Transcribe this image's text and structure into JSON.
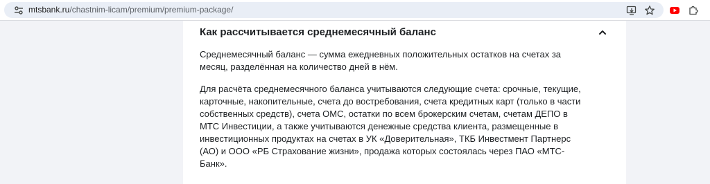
{
  "browser": {
    "url_host": "mtsbank.ru",
    "url_path": "/chastnim-licam/premium/premium-package/"
  },
  "accordion": {
    "title": "Как рассчитывается среднемесячный баланс",
    "expanded": true,
    "paragraphs": [
      "Среднемесячный баланс — сумма ежедневных положительных остатков на счетах за месяц, разделённая на количество дней в нём.",
      "Для расчёта среднемесячного баланса учитываются следующие счета: срочные, текущие, карточные, накопительные, счета до востребования, счета кредитных карт (только в части собственных средств), счета ОМС, остатки по всем брокерским счетам, счетам ДЕПО в МТС Инвестиции, а также учитываются денежные средства клиента, размещенные в инвестиционных продуктах на счетах в УК «Доверительная», ТКБ Инвестмент Партнерс (АО) и ООО «РБ Страхование жизни», продажа которых состоялась через ПАО «МТС-Банк»."
    ]
  },
  "icons": {
    "site_info": "site-settings-icon",
    "install": "install-app-icon",
    "bookmark": "star-icon",
    "extension_youtube": "youtube-icon",
    "extensions": "puzzle-icon",
    "accordion_toggle": "chevron-up-icon"
  },
  "colors": {
    "page_bg": "#f2f3f7",
    "card_bg": "#ffffff",
    "text": "#1d2023",
    "omnibox_bg": "#e9eef6",
    "youtube_red": "#ff0000"
  }
}
